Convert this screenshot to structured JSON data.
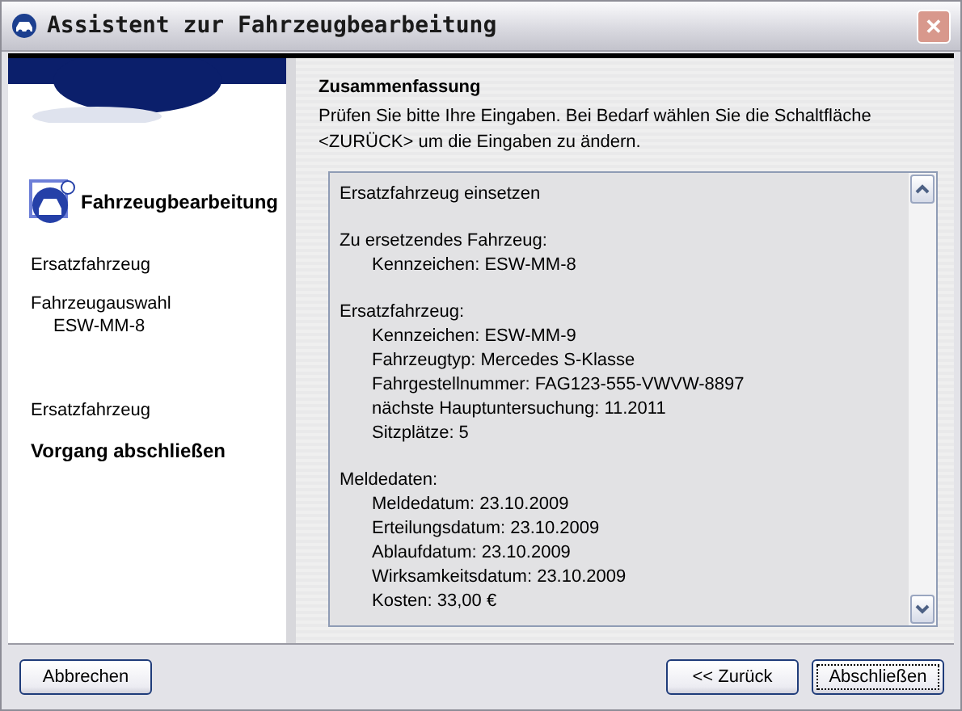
{
  "window": {
    "title": "Assistent zur Fahrzeugbearbeitung",
    "close": "✕"
  },
  "sidebar": {
    "heading": "Fahrzeugbearbeitung",
    "steps": [
      {
        "label": "Ersatzfahrzeug",
        "current": false
      },
      {
        "label": "Fahrzeugauswahl",
        "detail": "ESW-MM-8",
        "current": false
      },
      {
        "label": "Ersatzfahrzeug",
        "current": false
      },
      {
        "label": "Vorgang abschließen",
        "current": true
      }
    ]
  },
  "page": {
    "title": "Zusammenfassung",
    "description": "Prüfen Sie bitte Ihre Eingaben. Bei Bedarf wählen Sie die Schaltfläche <ZURÜCK> um die Eingaben zu ändern."
  },
  "summary": {
    "title": "Ersatzfahrzeug einsetzen",
    "sections": [
      {
        "heading": "Zu ersetzendes Fahrzeug:",
        "lines": [
          "Kennzeichen: ESW-MM-8"
        ]
      },
      {
        "heading": "Ersatzfahrzeug:",
        "lines": [
          "Kennzeichen: ESW-MM-9",
          "Fahrzeugtyp: Mercedes S-Klasse",
          "Fahrgestellnummer: FAG123-555-VWVW-8897",
          "nächste Hauptuntersuchung: 11.2011",
          "Sitzplätze: 5"
        ]
      },
      {
        "heading": "Meldedaten:",
        "lines": [
          "Meldedatum: 23.10.2009",
          "Erteilungsdatum: 23.10.2009",
          "Ablaufdatum: 23.10.2009",
          "Wirksamkeitsdatum: 23.10.2009",
          "Kosten: 33,00 €"
        ]
      }
    ]
  },
  "buttons": [
    {
      "label": "Abbrechen",
      "kind": "left",
      "default": false
    },
    {
      "label": "<< Zurück",
      "kind": "right",
      "default": false
    },
    {
      "label": "Abschließen",
      "kind": "right",
      "default": true
    }
  ]
}
